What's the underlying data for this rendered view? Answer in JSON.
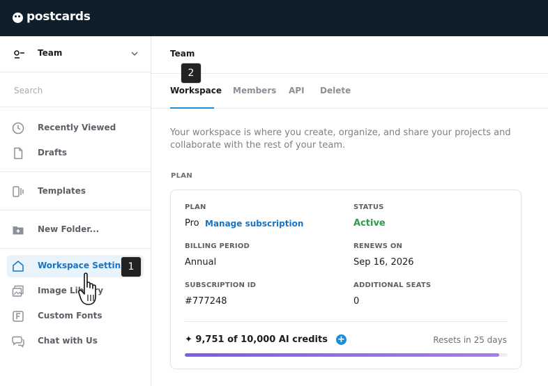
{
  "app": {
    "brand": "postcards"
  },
  "sidebar": {
    "team_name": "Team",
    "search_placeholder": "Search",
    "items": [
      {
        "label": "Recently Viewed",
        "icon": "clock-icon"
      },
      {
        "label": "Drafts",
        "icon": "document-icon"
      },
      {
        "label": "Templates",
        "icon": "templates-icon"
      },
      {
        "label": "New Folder...",
        "icon": "folder-plus-icon"
      },
      {
        "label": "Workspace Settings",
        "icon": "home-icon",
        "active": true
      },
      {
        "label": "Image Library",
        "icon": "image-library-icon"
      },
      {
        "label": "Custom Fonts",
        "icon": "font-icon"
      },
      {
        "label": "Chat with Us",
        "icon": "chat-icon"
      }
    ]
  },
  "main": {
    "title": "Team",
    "tabs": [
      {
        "label": "Workspace",
        "active": true
      },
      {
        "label": "Members"
      },
      {
        "label": "API"
      },
      {
        "label": "Delete"
      }
    ],
    "intro": "Your workspace is where you create, organize, and share your projects and collaborate with the rest of your team.",
    "section_label": "PLAN",
    "plan": {
      "plan_label": "PLAN",
      "plan_value": "Pro",
      "manage_link": "Manage subscription",
      "status_label": "STATUS",
      "status_value": "Active",
      "billing_label": "BILLING PERIOD",
      "billing_value": "Annual",
      "renews_label": "RENEWS ON",
      "renews_value": "Sep 16, 2026",
      "sub_id_label": "SUBSCRIPTION ID",
      "sub_id_value": "#777248",
      "seats_label": "ADDITIONAL SEATS",
      "seats_value": "0",
      "credits_text": "✦ 9,751 of 10,000 AI credits",
      "resets_text": "Resets in 25 days",
      "credits_used_fraction": 0.9751
    }
  },
  "overlays": {
    "badge_1": "1",
    "badge_2": "2"
  },
  "colors": {
    "topbar": "#0f1f2a",
    "accent": "#1f8dd6",
    "active_bg": "#e8f3fb",
    "status_green": "#2e9b4a",
    "progress": "#7b5ce8"
  }
}
